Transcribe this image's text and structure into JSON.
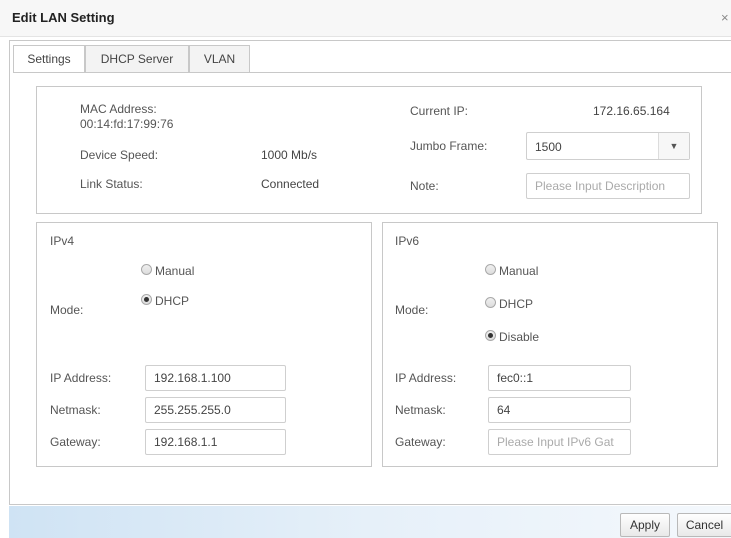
{
  "dialog": {
    "title": "Edit LAN Setting",
    "close_glyph": "×"
  },
  "tabs": [
    {
      "label": "Settings",
      "active": true
    },
    {
      "label": "DHCP Server",
      "active": false
    },
    {
      "label": "VLAN",
      "active": false
    }
  ],
  "info": {
    "mac_label": "MAC Address:",
    "mac_value": "00:14:fd:17:99:76",
    "speed_label": "Device Speed:",
    "speed_value": "1000 Mb/s",
    "link_label": "Link Status:",
    "link_value": "Connected",
    "current_ip_label": "Current IP:",
    "current_ip_value": "172.16.65.164",
    "jumbo_label": "Jumbo Frame:",
    "jumbo_value": "1500",
    "note_label": "Note:",
    "note_placeholder": "Please Input Description"
  },
  "ipv4": {
    "heading": "IPv4",
    "mode_label": "Mode:",
    "modes": [
      {
        "label": "Manual",
        "checked": false
      },
      {
        "label": "DHCP",
        "checked": true
      }
    ],
    "ip_label": "IP Address:",
    "ip_value": "192.168.1.100",
    "netmask_label": "Netmask:",
    "netmask_value": "255.255.255.0",
    "gateway_label": "Gateway:",
    "gateway_value": "192.168.1.1"
  },
  "ipv6": {
    "heading": "IPv6",
    "mode_label": "Mode:",
    "modes": [
      {
        "label": "Manual",
        "checked": false
      },
      {
        "label": "DHCP",
        "checked": false
      },
      {
        "label": "Disable",
        "checked": true
      }
    ],
    "ip_label": "IP Address:",
    "ip_value": "fec0::1",
    "netmask_label": "Netmask:",
    "netmask_value": "64",
    "gateway_label": "Gateway:",
    "gateway_placeholder": "Please Input IPv6 Gat"
  },
  "footer": {
    "apply_label": "Apply",
    "cancel_label": "Cancel"
  },
  "colors": {
    "footer_gradient_start": "#cfe3f4",
    "border": "#c8c8c8"
  },
  "icons": {
    "close": "close-icon",
    "dropdown": "chevron-down-icon"
  }
}
